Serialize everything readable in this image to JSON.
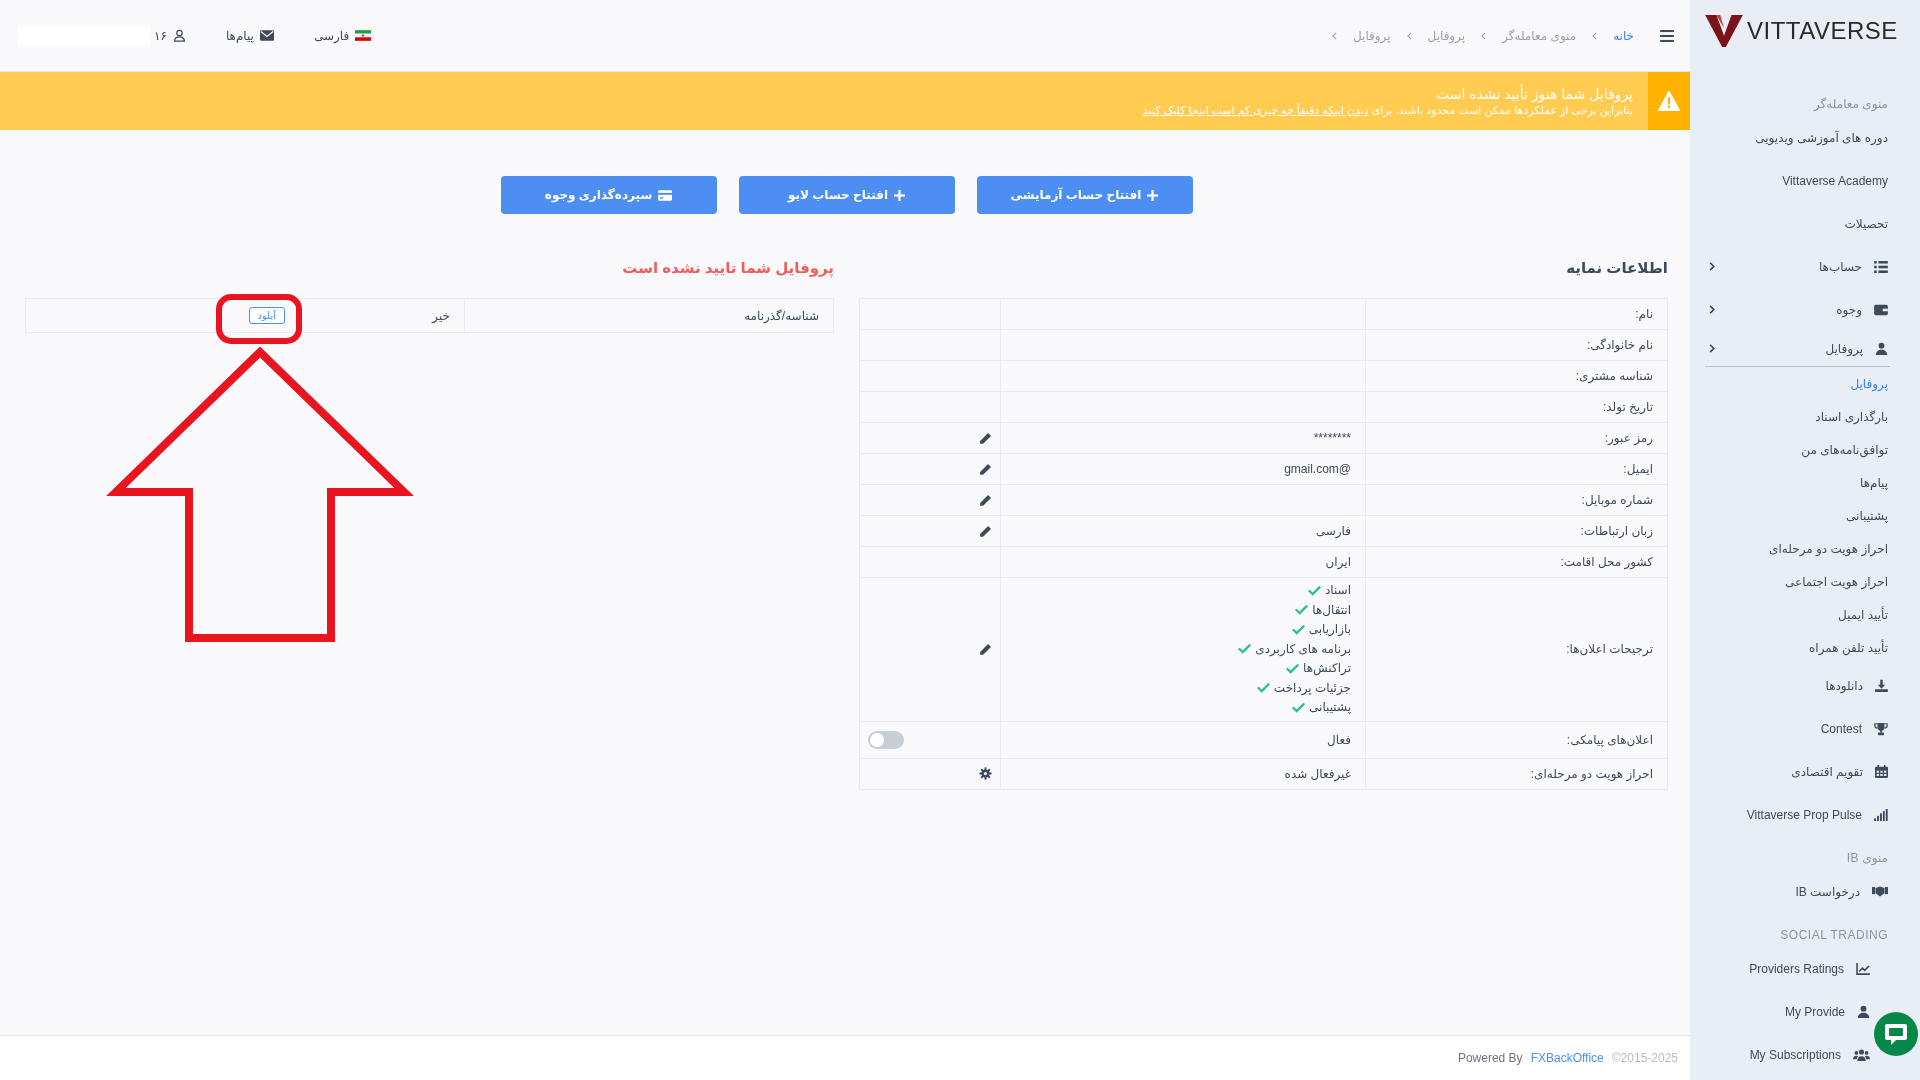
{
  "topbar": {
    "breadcrumb": [
      {
        "label": "خانه",
        "link": true
      },
      {
        "label": "منوی معامله‌گر",
        "link": false
      },
      {
        "label": "پروفایل",
        "link": false
      },
      {
        "label": "پروفایل",
        "link": false
      }
    ],
    "language": "فارسی",
    "messages": "پیام‌ها",
    "account": "۱۶"
  },
  "banner": {
    "title": "پروفایل شما هنوز تأیید نشده است",
    "message": "بنابراین برخی از عملکردها ممکن است محدود باشند. برای",
    "link": "دیدن اینکه دقیقاً چه چیزی کم است اینجا کلیک کنید"
  },
  "actions": [
    {
      "label": "افتتاح حساب آزمایشی",
      "kind": "add"
    },
    {
      "label": "افتتاح حساب لایو",
      "kind": "add"
    },
    {
      "label": "سپرده‌گذاری وجوه",
      "kind": "deposit"
    }
  ],
  "profile_info": {
    "title": "اطلاعات نمایه",
    "rows": [
      {
        "label": "نام:",
        "kind": "plain"
      },
      {
        "label": "نام خانوادگی:",
        "kind": "plain"
      },
      {
        "label": "شناسه مشتری:",
        "kind": "plain"
      },
      {
        "label": "تاریخ تولد:",
        "kind": "plain"
      },
      {
        "label": "رمز عبور:",
        "value": "********",
        "kind": "edit"
      },
      {
        "label": "ایمیل:",
        "value": "@gmail.com",
        "kind": "edit"
      },
      {
        "label": "شماره موبایل:",
        "kind": "edit"
      },
      {
        "label": "زبان ارتباطات:",
        "value": "فارسی",
        "kind": "edit"
      },
      {
        "label": "کشور محل اقامت:",
        "value": "ایران",
        "kind": "plain"
      },
      {
        "label": "ترجیحات اعلان‌ها:",
        "kind": "edit",
        "items": [
          {
            "label": "اسناد",
            "checked": true
          },
          {
            "label": "انتقال‌ها",
            "checked": true
          },
          {
            "label": "بازاریابی",
            "checked": true
          },
          {
            "label": "برنامه های کاربردی",
            "checked": true
          },
          {
            "label": "تراکنش‌ها",
            "checked": true
          },
          {
            "label": "جزئیات پرداخت",
            "checked": true
          },
          {
            "label": "پشتیبانی",
            "checked": true
          }
        ]
      },
      {
        "label": "اعلان‌های پیامکی:",
        "value": "فعال",
        "kind": "toggle",
        "on": false
      },
      {
        "label": "احراز هویت دو مرحله‌ای:",
        "value": "غیرفعال شده",
        "kind": "settings"
      }
    ]
  },
  "documents": {
    "title": "پروفایل شما تایید نشده است",
    "rows": [
      {
        "label": "شناسه/گذرنامه",
        "value": "خیر",
        "button": "آپلود"
      }
    ]
  },
  "sidebar": {
    "brand": "VITTAVERSE",
    "sections": [
      {
        "heading": "منوی معامله‌گر",
        "items": [
          {
            "label": "دوره های آموزشی ویدیویی",
            "kind": "link",
            "selected": false
          },
          {
            "label": "Vittaverse Academy",
            "kind": "link",
            "selected": false
          },
          {
            "label": "تحصیلات",
            "kind": "link",
            "selected": false
          },
          {
            "label": "حساب‌ها",
            "kind": "group",
            "expanded": false,
            "selected": false
          },
          {
            "label": "وجوه",
            "kind": "group",
            "expanded": false,
            "selected": false
          },
          {
            "label": "پروفایل",
            "kind": "group",
            "expanded": true,
            "selected": false,
            "children": [
              {
                "label": "پروفایل",
                "kind": "link",
                "selected": true
              },
              {
                "label": "بارگذاری اسناد",
                "kind": "link",
                "selected": false
              },
              {
                "label": "توافق‌نامه‌های من",
                "kind": "link",
                "selected": false
              },
              {
                "label": "پیام‌ها",
                "kind": "link",
                "selected": false
              },
              {
                "label": "پشتیبانی",
                "kind": "link",
                "selected": false
              },
              {
                "label": "احراز هویت دو مرحله‌ای",
                "kind": "link",
                "selected": false
              },
              {
                "label": "احراز هویت اجتماعی",
                "kind": "link",
                "selected": false
              },
              {
                "label": "تأیید ایمیل",
                "kind": "link",
                "selected": false
              },
              {
                "label": "تأیید تلفن همراه",
                "kind": "link",
                "selected": false
              }
            ]
          },
          {
            "label": "دانلودها",
            "kind": "link",
            "selected": false
          },
          {
            "label": "Contest",
            "kind": "link",
            "selected": false
          },
          {
            "label": "تقویم اقتصادی",
            "kind": "link",
            "selected": false
          },
          {
            "label": "Vittaverse Prop Pulse",
            "kind": "link",
            "selected": false
          }
        ]
      },
      {
        "heading": "منوی IB",
        "items": [
          {
            "label": "درخواست IB",
            "kind": "link",
            "selected": false
          }
        ]
      },
      {
        "heading": "SOCIAL TRADING",
        "items": [
          {
            "label": "Providers Ratings",
            "kind": "link",
            "selected": false
          },
          {
            "label": "My Provide",
            "kind": "link",
            "selected": false
          },
          {
            "label": "My Subscriptions",
            "kind": "link",
            "selected": false
          }
        ]
      }
    ]
  },
  "footer": {
    "powered_by": "Powered By",
    "link": "FXBackOffice",
    "copyright": "©2015-2025"
  }
}
